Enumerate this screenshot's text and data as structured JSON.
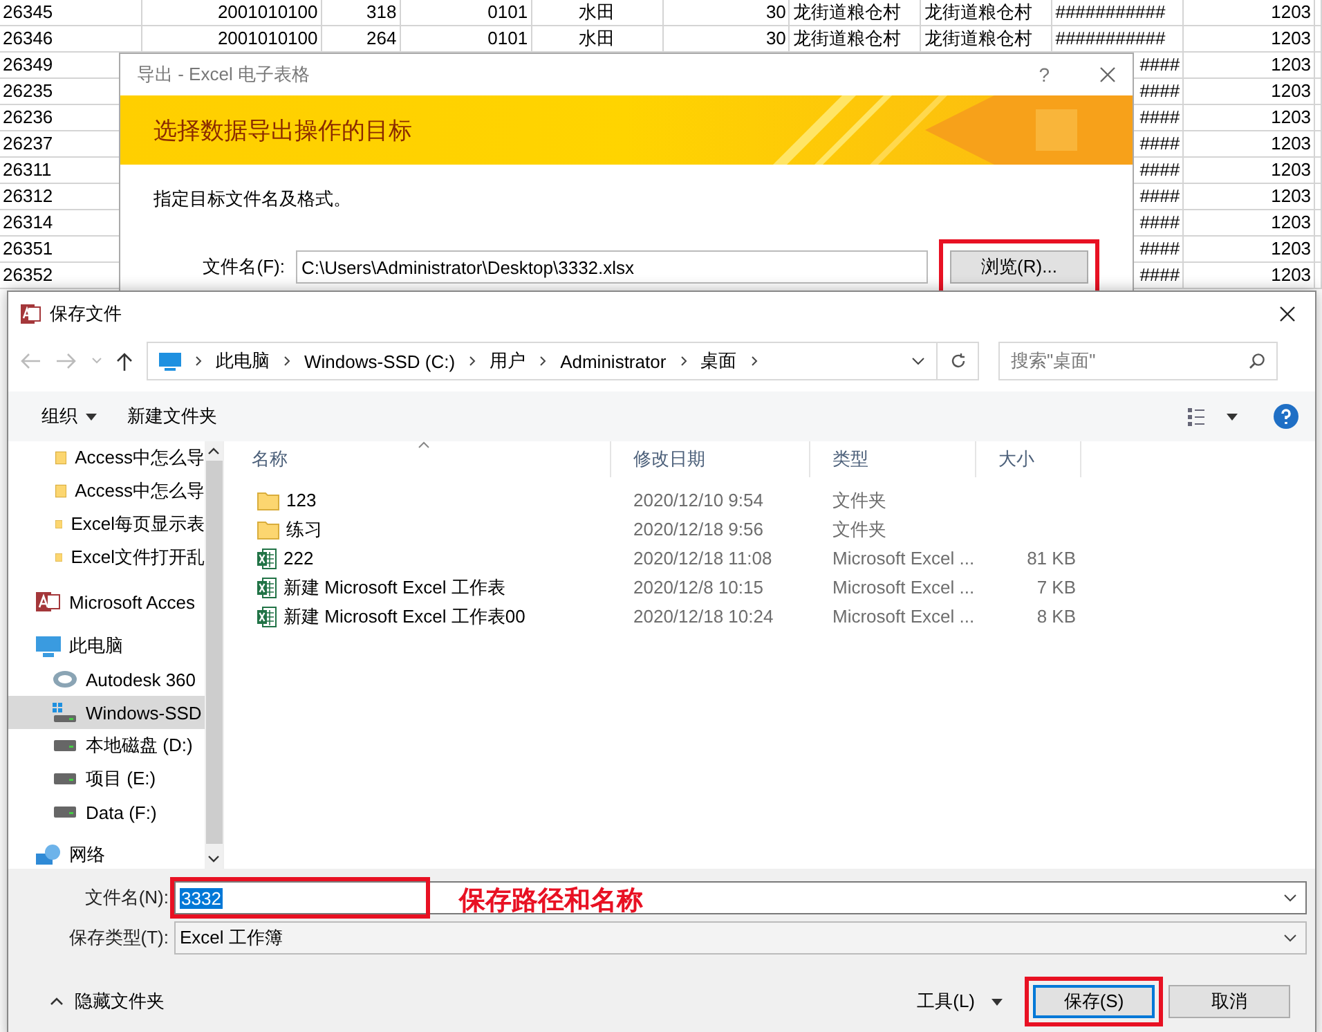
{
  "spreadsheet": {
    "rows": [
      {
        "cells": [
          "26345",
          "2001010100",
          "318",
          "0101",
          "水田",
          "30",
          "龙街道粮仓村",
          "龙街道粮仓村",
          "###########",
          "1203"
        ]
      },
      {
        "cells": [
          "26346",
          "2001010100",
          "264",
          "0101",
          "水田",
          "30",
          "龙街道粮仓村",
          "龙街道粮仓村",
          "###########",
          "1203"
        ]
      },
      {
        "first": "26349",
        "last": [
          "####",
          "1203"
        ]
      },
      {
        "first": "26235",
        "last": [
          "####",
          "1203"
        ]
      },
      {
        "first": "26236",
        "last": [
          "####",
          "1203"
        ]
      },
      {
        "first": "26237",
        "last": [
          "####",
          "1203"
        ]
      },
      {
        "first": "26311",
        "last": [
          "####",
          "1203"
        ]
      },
      {
        "first": "26312",
        "last": [
          "####",
          "1203"
        ]
      },
      {
        "first": "26314",
        "last": [
          "####",
          "1203"
        ]
      },
      {
        "first": "26351",
        "last": [
          "####",
          "1203"
        ]
      },
      {
        "first": "26352",
        "last": [
          "####",
          "1203"
        ]
      }
    ]
  },
  "export_dialog": {
    "title": "导出 - Excel 电子表格",
    "help": "?",
    "banner": "选择数据导出操作的目标",
    "instruction": "指定目标文件名及格式。",
    "file_label": "文件名(F):",
    "file_value": "C:\\Users\\Administrator\\Desktop\\3332.xlsx",
    "browse": "浏览(R)...",
    "browse_highlighted": true
  },
  "save_dialog": {
    "title": "保存文件",
    "breadcrumb": [
      "此电脑",
      "Windows-SSD (C:)",
      "用户",
      "Administrator",
      "桌面"
    ],
    "search": {
      "placeholder": "搜索\"桌面\""
    },
    "toolbar": {
      "organize": "组织",
      "new_folder": "新建文件夹"
    },
    "sidebar": [
      {
        "label": "Access中怎么导",
        "kind": "folder",
        "selected": false
      },
      {
        "label": "Access中怎么导",
        "kind": "folder",
        "selected": false
      },
      {
        "label": "Excel每页显示表",
        "kind": "folder",
        "selected": false
      },
      {
        "label": "Excel文件打开乱",
        "kind": "folder",
        "selected": false
      },
      {
        "label": "Microsoft Acces",
        "kind": "access",
        "selected": false
      },
      {
        "label": "此电脑",
        "kind": "pc",
        "selected": false,
        "children": [
          {
            "label": "Autodesk 360",
            "kind": "cloud",
            "selected": false
          },
          {
            "label": "Windows-SSD",
            "kind": "windrive",
            "selected": true
          },
          {
            "label": "本地磁盘 (D:)",
            "kind": "drive",
            "selected": false
          },
          {
            "label": "项目 (E:)",
            "kind": "drive",
            "selected": false
          },
          {
            "label": "Data (F:)",
            "kind": "drive",
            "selected": false
          }
        ]
      },
      {
        "label": "网络",
        "kind": "network",
        "selected": false
      }
    ],
    "columns": [
      {
        "label": "名称",
        "sorted": true
      },
      {
        "label": "修改日期",
        "sorted": false
      },
      {
        "label": "类型",
        "sorted": false
      },
      {
        "label": "大小",
        "sorted": false
      }
    ],
    "files": [
      {
        "name": "123",
        "date": "2020/12/10 9:54",
        "type": "文件夹",
        "kind": "folder"
      },
      {
        "name": "练习",
        "date": "2020/12/18 9:56",
        "type": "文件夹",
        "kind": "folder"
      },
      {
        "name": "222",
        "date": "2020/12/18 11:08",
        "type": "Microsoft Excel ...",
        "size": "81 KB",
        "kind": "excel"
      },
      {
        "name": "新建 Microsoft Excel 工作表",
        "date": "2020/12/8 10:15",
        "type": "Microsoft Excel ...",
        "size": "7 KB",
        "kind": "excel"
      },
      {
        "name": "新建 Microsoft Excel 工作表00",
        "date": "2020/12/18 10:24",
        "type": "Microsoft Excel ...",
        "size": "8 KB",
        "kind": "excel"
      }
    ],
    "file_name_label": "文件名(N):",
    "file_name_value": "3332",
    "file_name_value_selected": true,
    "file_name_highlighted": true,
    "annotation": "保存路径和名称",
    "type_label": "保存类型(T):",
    "type_value": "Excel 工作簿",
    "hide_folders": "隐藏文件夹",
    "tools": "工具(L)",
    "save": "保存(S)",
    "save_highlighted": true,
    "cancel": "取消"
  }
}
